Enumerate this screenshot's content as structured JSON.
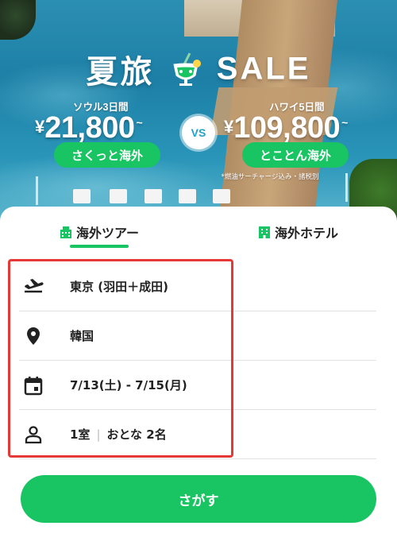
{
  "banner": {
    "title_left": "夏旅",
    "title_right": "SALE",
    "left": {
      "route": "ソウル3日間",
      "currency": "¥",
      "price": "21,800",
      "suffix": "~",
      "cta": "さくっと海外"
    },
    "vs": "VS",
    "right": {
      "route": "ハワイ5日間",
      "currency": "¥",
      "price": "109,800",
      "suffix": "~",
      "cta": "とことん海外"
    },
    "note": "*燃油サーチャージ込み・諸税別"
  },
  "tabs": [
    {
      "label": "海外ツアー",
      "icon": "tour-building-icon",
      "active": true
    },
    {
      "label": "海外ホテル",
      "icon": "hotel-building-icon",
      "active": false
    }
  ],
  "form": {
    "departure": {
      "icon": "airplane-takeoff-icon",
      "value": "東京 (羽田＋成田)"
    },
    "destination": {
      "icon": "location-pin-icon",
      "value": "韓国"
    },
    "dates": {
      "icon": "calendar-icon",
      "value": "7/13(土) - 7/15(月)"
    },
    "guests": {
      "icon": "person-icon",
      "rooms": "1室",
      "separator": "|",
      "people": "おとな 2名"
    }
  },
  "search_button": {
    "label": "さがす"
  },
  "colors": {
    "accent": "#19c562",
    "highlight_border": "#e53935",
    "vs_text": "#1fa3c8"
  }
}
